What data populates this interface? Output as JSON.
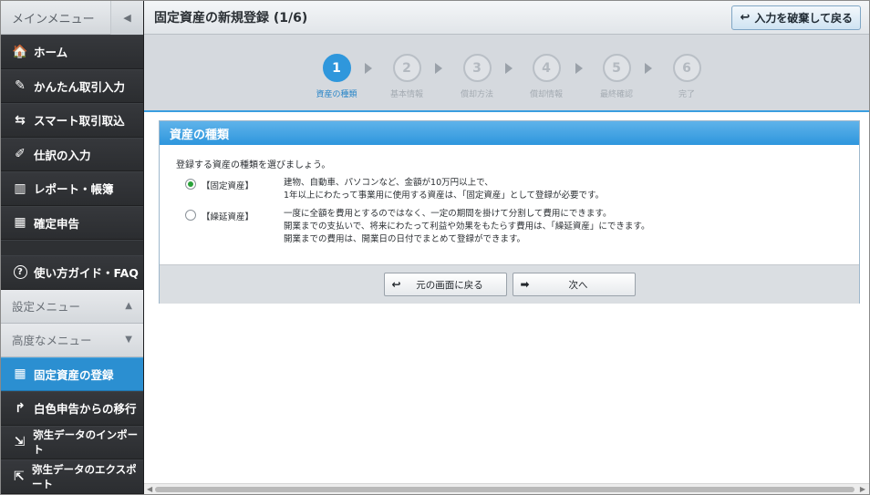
{
  "sidebar": {
    "title": "メインメニュー",
    "collapse_icon": "◀",
    "items": [
      {
        "label": "ホーム",
        "icon": "🏠"
      },
      {
        "label": "かんたん取引入力",
        "icon": "✎"
      },
      {
        "label": "スマート取引取込",
        "icon": "⇆"
      },
      {
        "label": "仕訳の入力",
        "icon": "✐"
      },
      {
        "label": "レポート・帳簿",
        "icon": "▥"
      },
      {
        "label": "確定申告",
        "icon": "▦"
      }
    ],
    "guide": {
      "label": "使い方ガイド・FAQ",
      "icon": "?"
    },
    "settings_menu": {
      "label": "設定メニュー",
      "icon": "▲"
    },
    "advanced_menu": {
      "label": "高度なメニュー",
      "icon": "▼"
    },
    "sub_items": [
      {
        "label": "固定資産の登録",
        "icon": "▦"
      },
      {
        "label": "白色申告からの移行",
        "icon": "↱"
      },
      {
        "label": "弥生データのインポート",
        "icon": "⇲"
      },
      {
        "label": "弥生データのエクスポート",
        "icon": "⇱"
      }
    ],
    "active_color": "#2b8fd1"
  },
  "header": {
    "title": "固定資産の新規登録 (1/6)",
    "discard_button": "入力を破棄して戻る",
    "discard_icon": "↩"
  },
  "steps": [
    {
      "num": "1",
      "label": "資産の種類"
    },
    {
      "num": "2",
      "label": "基本情報"
    },
    {
      "num": "3",
      "label": "償却方法"
    },
    {
      "num": "4",
      "label": "償却情報"
    },
    {
      "num": "5",
      "label": "最終確認"
    },
    {
      "num": "6",
      "label": "完了"
    }
  ],
  "panel": {
    "title": "資産の種類",
    "instruction": "登録する資産の種類を選びましょう。",
    "options": [
      {
        "label": "【固定資産】",
        "selected": true,
        "lines": [
          "建物、自動車、パソコンなど、金額が10万円以上で、",
          "1年以上にわたって事業用に使用する資産は、「固定資産」として登録が必要です。"
        ]
      },
      {
        "label": "【繰延資産】",
        "selected": false,
        "lines": [
          "一度に全額を費用とするのではなく、一定の期間を掛けて分割して費用にできます。",
          "開業までの支払いで、将来にわたって利益や効果をもたらす費用は、「繰延資産」にできます。",
          "開業までの費用は、開業日の日付でまとめて登録ができます。"
        ]
      }
    ],
    "back_button": "元の画面に戻る",
    "back_icon": "↩",
    "next_button": "次へ",
    "next_icon": "➡"
  }
}
